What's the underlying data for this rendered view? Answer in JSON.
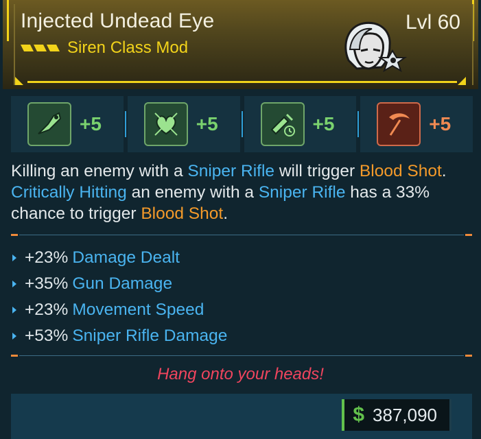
{
  "item": {
    "name": "Injected Undead Eye",
    "level": "Lvl 60",
    "class_mod": "Siren Class Mod",
    "rarity_color": "#f2d31a",
    "portrait_icon": "siren-portrait-icon"
  },
  "skills": [
    {
      "icon": "sniper-rifle-skill-icon",
      "bonus": "+5",
      "color": "green"
    },
    {
      "icon": "heart-skill-icon",
      "bonus": "+5",
      "color": "green"
    },
    {
      "icon": "syringe-timer-skill-icon",
      "bonus": "+5",
      "color": "green"
    },
    {
      "icon": "scythe-skill-icon",
      "bonus": "+5",
      "color": "red"
    }
  ],
  "description": {
    "p1": "Killing an enemy with a ",
    "k1": "Sniper Rifle",
    "p2": " will trigger ",
    "k2": "Blood Shot",
    "p3": ". ",
    "k3": "Critically Hitting",
    "p4": " an enemy with a ",
    "k4": "Sniper Rifle",
    "p5": " has a 33% chance to trigger ",
    "k5": "Blood Shot",
    "p6": "."
  },
  "stats": [
    {
      "amount": "+23%",
      "name": "Damage Dealt"
    },
    {
      "amount": "+35%",
      "name": "Gun Damage"
    },
    {
      "amount": "+23%",
      "name": "Movement Speed"
    },
    {
      "amount": "+53%",
      "name": "Sniper Rifle Damage"
    }
  ],
  "flavor": "Hang onto your heads!",
  "price": {
    "symbol": "$",
    "value": "387,090"
  },
  "colors": {
    "keyword_blue": "#4ab4f0",
    "keyword_orange": "#f49a2a",
    "flavor_red": "#f0455e",
    "money_green": "#63c14c"
  }
}
